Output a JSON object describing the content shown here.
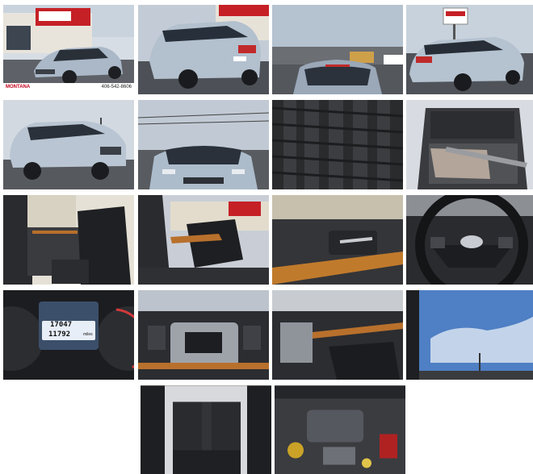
{
  "gallery": {
    "dealer": {
      "logo_text": "MONTANA",
      "phone": "406-542-8606",
      "sign_text": "MONTANA"
    },
    "odometer": {
      "total": "17047",
      "trip": "11792",
      "unit": "miles"
    },
    "photos": [
      {
        "subject": "front three-quarter exterior at dealership"
      },
      {
        "subject": "rear three-quarter exterior"
      },
      {
        "subject": "rear view"
      },
      {
        "subject": "rear three-quarter with dealer sign"
      },
      {
        "subject": "front three-quarter side"
      },
      {
        "subject": "front view"
      },
      {
        "subject": "tire tread close-up"
      },
      {
        "subject": "cargo area with floor mats"
      },
      {
        "subject": "rear door panel and rear seat"
      },
      {
        "subject": "driver seat through open door"
      },
      {
        "subject": "door handle with wood trim"
      },
      {
        "subject": "steering wheel"
      },
      {
        "subject": "instrument cluster odometer"
      },
      {
        "subject": "center console head unit"
      },
      {
        "subject": "dashboard passenger side"
      },
      {
        "subject": "sunroof sky view"
      },
      {
        "subject": "rear seat row"
      },
      {
        "subject": "engine bay"
      }
    ]
  }
}
